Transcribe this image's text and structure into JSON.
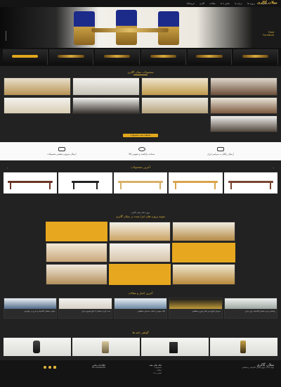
{
  "brand": {
    "logo_text": "میلان گالری"
  },
  "topnav": {
    "items": [
      "خانه",
      "محصولات",
      "پروژه ها",
      "درباره ما",
      "تماس با ما",
      "مقالات",
      "گالری",
      "فروشگاه"
    ]
  },
  "hero": {
    "caption_line1": "Yinst",
    "caption_line2": "Furniture"
  },
  "products_section": {
    "title": "محصولات میلان گالری",
    "button": "مشاهده همه محصولات"
  },
  "features": [
    {
      "icon": "truck-icon",
      "label": "ارسال رایگان به سراسر ایران"
    },
    {
      "icon": "gift-icon",
      "label": "ضمانت بازگشت و تعویض کالا"
    },
    {
      "icon": "shipping-icon",
      "label": "ارسال سریع و مطمئن محصولات"
    }
  ],
  "newest": {
    "title": "آخرین محصولات"
  },
  "projects": {
    "pretitle": "پروژه های میلان گالری",
    "title": "نمونه پروژه های اجرا شده در میلان گالری"
  },
  "blog": {
    "title": "آخرین اخبار و مقالات",
    "posts": [
      "راهنمای خرید مبلمان کلاسیک برای منزل",
      "معرفی انواع میز ناهار خوری سلطنتی",
      "نکات مهم در انتخاب صندلی سلطنتی",
      "ست کردن مبلمان با دکوراسیون منزل",
      "تفاوت مبلمان کلاسیک و مدرن در طراحی"
    ]
  },
  "awards": {
    "title": "گواهی نامه ها"
  },
  "footer": {
    "about_title": "میلان گالری",
    "about_text": "تولید کننده انواع مبلمان کلاسیک و سلطنتی",
    "links_title": "لینک های مفید",
    "links": [
      "محصولات",
      "مقالات",
      "تماس با ما"
    ],
    "contact_title": "اطلاعات تماس",
    "phone": "021-00000000"
  },
  "colors": {
    "accent": "#e0a61c",
    "dark": "#222222",
    "gold": "#e0b43a"
  }
}
